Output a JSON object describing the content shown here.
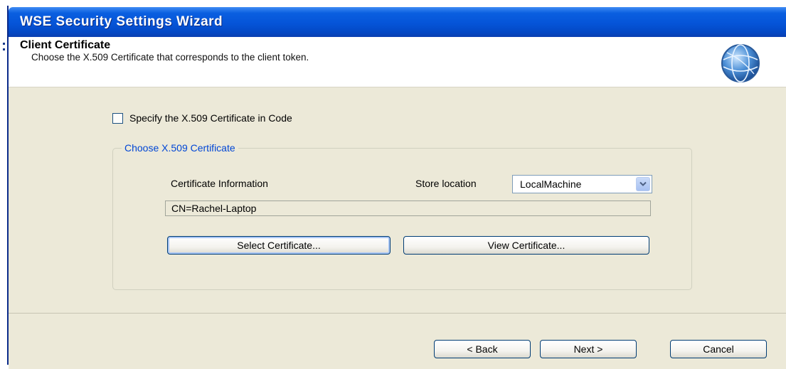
{
  "window": {
    "title": "WSE Security Settings Wizard"
  },
  "header": {
    "title": "Client Certificate",
    "subtitle": "Choose the X.509 Certificate that corresponds to the client token.",
    "icon": "globe-icon"
  },
  "options": {
    "specify_in_code": {
      "label": "Specify the X.509 Certificate in Code",
      "checked": false
    }
  },
  "certificate_group": {
    "legend": "Choose X.509 Certificate",
    "info_label": "Certificate Information",
    "store_label": "Store location",
    "store_value": "LocalMachine",
    "certificate_value": "CN=Rachel-Laptop",
    "select_button": "Select Certificate...",
    "view_button": "View Certificate..."
  },
  "footer": {
    "back_label": "< Back",
    "next_label": "Next >",
    "cancel_label": "Cancel"
  },
  "colors": {
    "titlebar": "#0554d8",
    "dialog_bg": "#ece9d8",
    "legend_text": "#0046d5"
  }
}
